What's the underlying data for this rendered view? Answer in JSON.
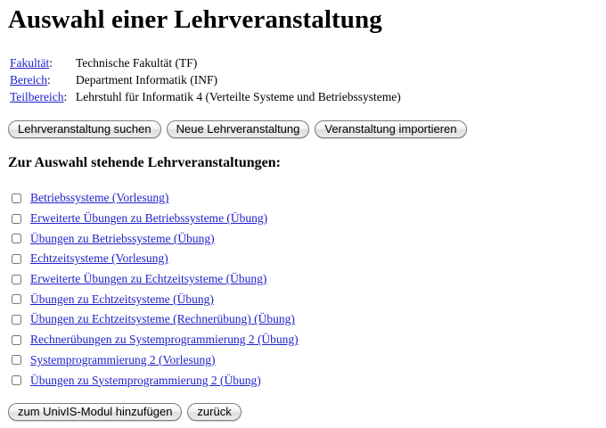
{
  "page": {
    "title": "Auswahl einer Lehrveranstaltung"
  },
  "info": {
    "rows": [
      {
        "label": "Fakultät",
        "value": "Technische Fakultät (TF)"
      },
      {
        "label": "Bereich",
        "value": "Department Informatik (INF)"
      },
      {
        "label": "Teilbereich",
        "value": "Lehrstuhl für Informatik 4 (Verteilte Systeme und Betriebssysteme)"
      }
    ],
    "separator": ":"
  },
  "toolbar": {
    "search_label": "Lehrveranstaltung suchen",
    "new_label": "Neue Lehrveranstaltung",
    "import_label": "Veranstaltung importieren"
  },
  "section": {
    "heading": "Zur Auswahl stehende Lehrveranstaltungen:"
  },
  "courses": [
    {
      "label": "Betriebssysteme (Vorlesung)",
      "checked": false
    },
    {
      "label": "Erweiterte Übungen zu Betriebssysteme (Übung)",
      "checked": false
    },
    {
      "label": "Übungen zu Betriebssysteme (Übung)",
      "checked": false
    },
    {
      "label": "Echtzeitsysteme (Vorlesung)",
      "checked": false
    },
    {
      "label": "Erweiterte Übungen zu Echtzeitsysteme (Übung)",
      "checked": false
    },
    {
      "label": "Übungen zu Echtzeitsysteme (Übung)",
      "checked": false
    },
    {
      "label": "Übungen zu Echtzeitsysteme (Rechnerübung) (Übung)",
      "checked": false
    },
    {
      "label": "Rechnerübungen zu Systemprogrammierung 2 (Übung)",
      "checked": false
    },
    {
      "label": "Systemprogrammierung 2 (Vorlesung)",
      "checked": false
    },
    {
      "label": "Übungen zu Systemprogrammierung 2 (Übung)",
      "checked": false
    }
  ],
  "footer": {
    "add_label": "zum UnivIS-Modul hinzufügen",
    "back_label": "zurück"
  },
  "colors": {
    "link": "#2020cc",
    "text": "#000000",
    "background": "#ffffff"
  }
}
